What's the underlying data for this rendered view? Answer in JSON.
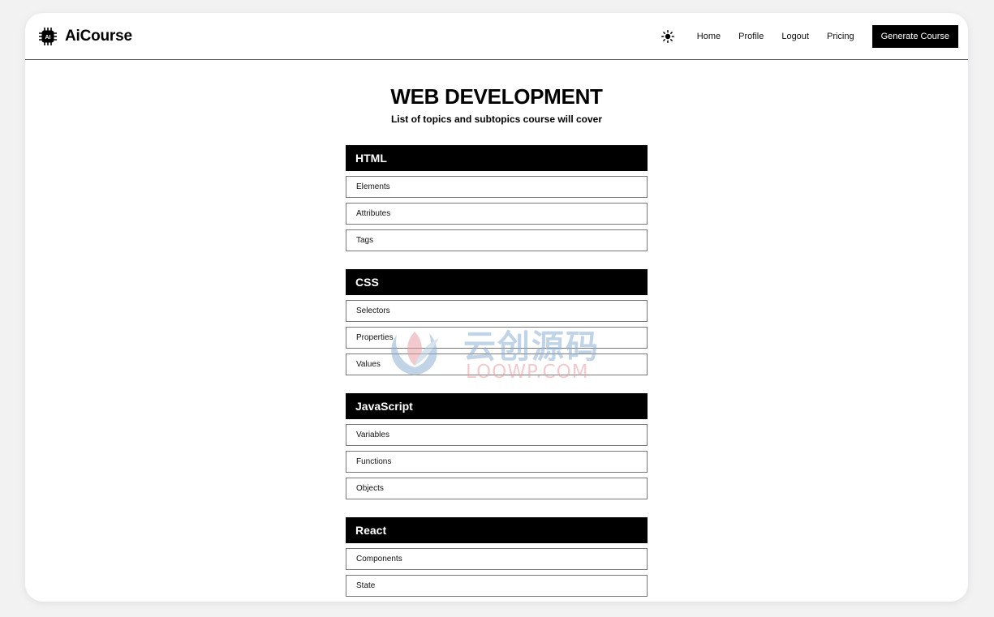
{
  "brand": {
    "name": "AiCourse",
    "logo_icon": "ai-chip-icon",
    "logo_text": "AI"
  },
  "nav": {
    "theme_icon": "sun-icon",
    "links": [
      "Home",
      "Profile",
      "Logout",
      "Pricing"
    ],
    "cta_label": "Generate Course"
  },
  "page": {
    "title": "WEB DEVELOPMENT",
    "subtitle": "List of topics and subtopics course will cover"
  },
  "topics": [
    {
      "title": "HTML",
      "subtopics": [
        "Elements",
        "Attributes",
        "Tags"
      ]
    },
    {
      "title": "CSS",
      "subtopics": [
        "Selectors",
        "Properties",
        "Values"
      ]
    },
    {
      "title": "JavaScript",
      "subtopics": [
        "Variables",
        "Functions",
        "Objects"
      ]
    },
    {
      "title": "React",
      "subtopics": [
        "Components",
        "State"
      ]
    }
  ],
  "watermark": {
    "text_cn": "云创源码",
    "text_en": "LOOWP.COM"
  },
  "colors": {
    "primary": "#000000",
    "background": "#ffffff",
    "border": "#777777"
  }
}
